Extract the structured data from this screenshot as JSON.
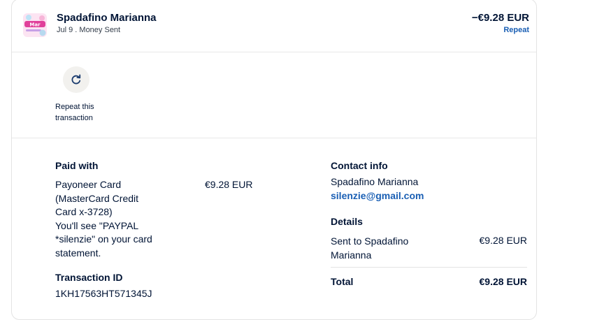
{
  "header": {
    "merchant_name": "Spadafino Marianna",
    "subtitle": "Jul 9 . Money Sent",
    "amount": "−€9.28 EUR",
    "repeat_label": "Repeat"
  },
  "repeat_action": {
    "label_line1": "Repeat this",
    "label_line2": "transaction",
    "icon": "refresh-icon"
  },
  "paid_with": {
    "title": "Paid with",
    "lines": [
      "Payoneer Card",
      "(MasterCard Credit",
      "Card x-3728)",
      "You'll see \"PAYPAL",
      "*silenzie\" on your card",
      "statement."
    ],
    "amount": "€9.28 EUR"
  },
  "transaction": {
    "title": "Transaction ID",
    "id": "1KH17563HT571345J"
  },
  "contact": {
    "title": "Contact info",
    "name": "Spadafino Marianna",
    "email": "silenzie@gmail.com"
  },
  "details": {
    "title": "Details",
    "sent_to_line1": "Sent to Spadafino",
    "sent_to_line2": "Marianna",
    "sent_amount": "€9.28 EUR",
    "total_label": "Total",
    "total_amount": "€9.28 EUR"
  },
  "colors": {
    "text": "#001435",
    "link": "#1a5fb4",
    "avatar_pink": "#e0409a"
  }
}
